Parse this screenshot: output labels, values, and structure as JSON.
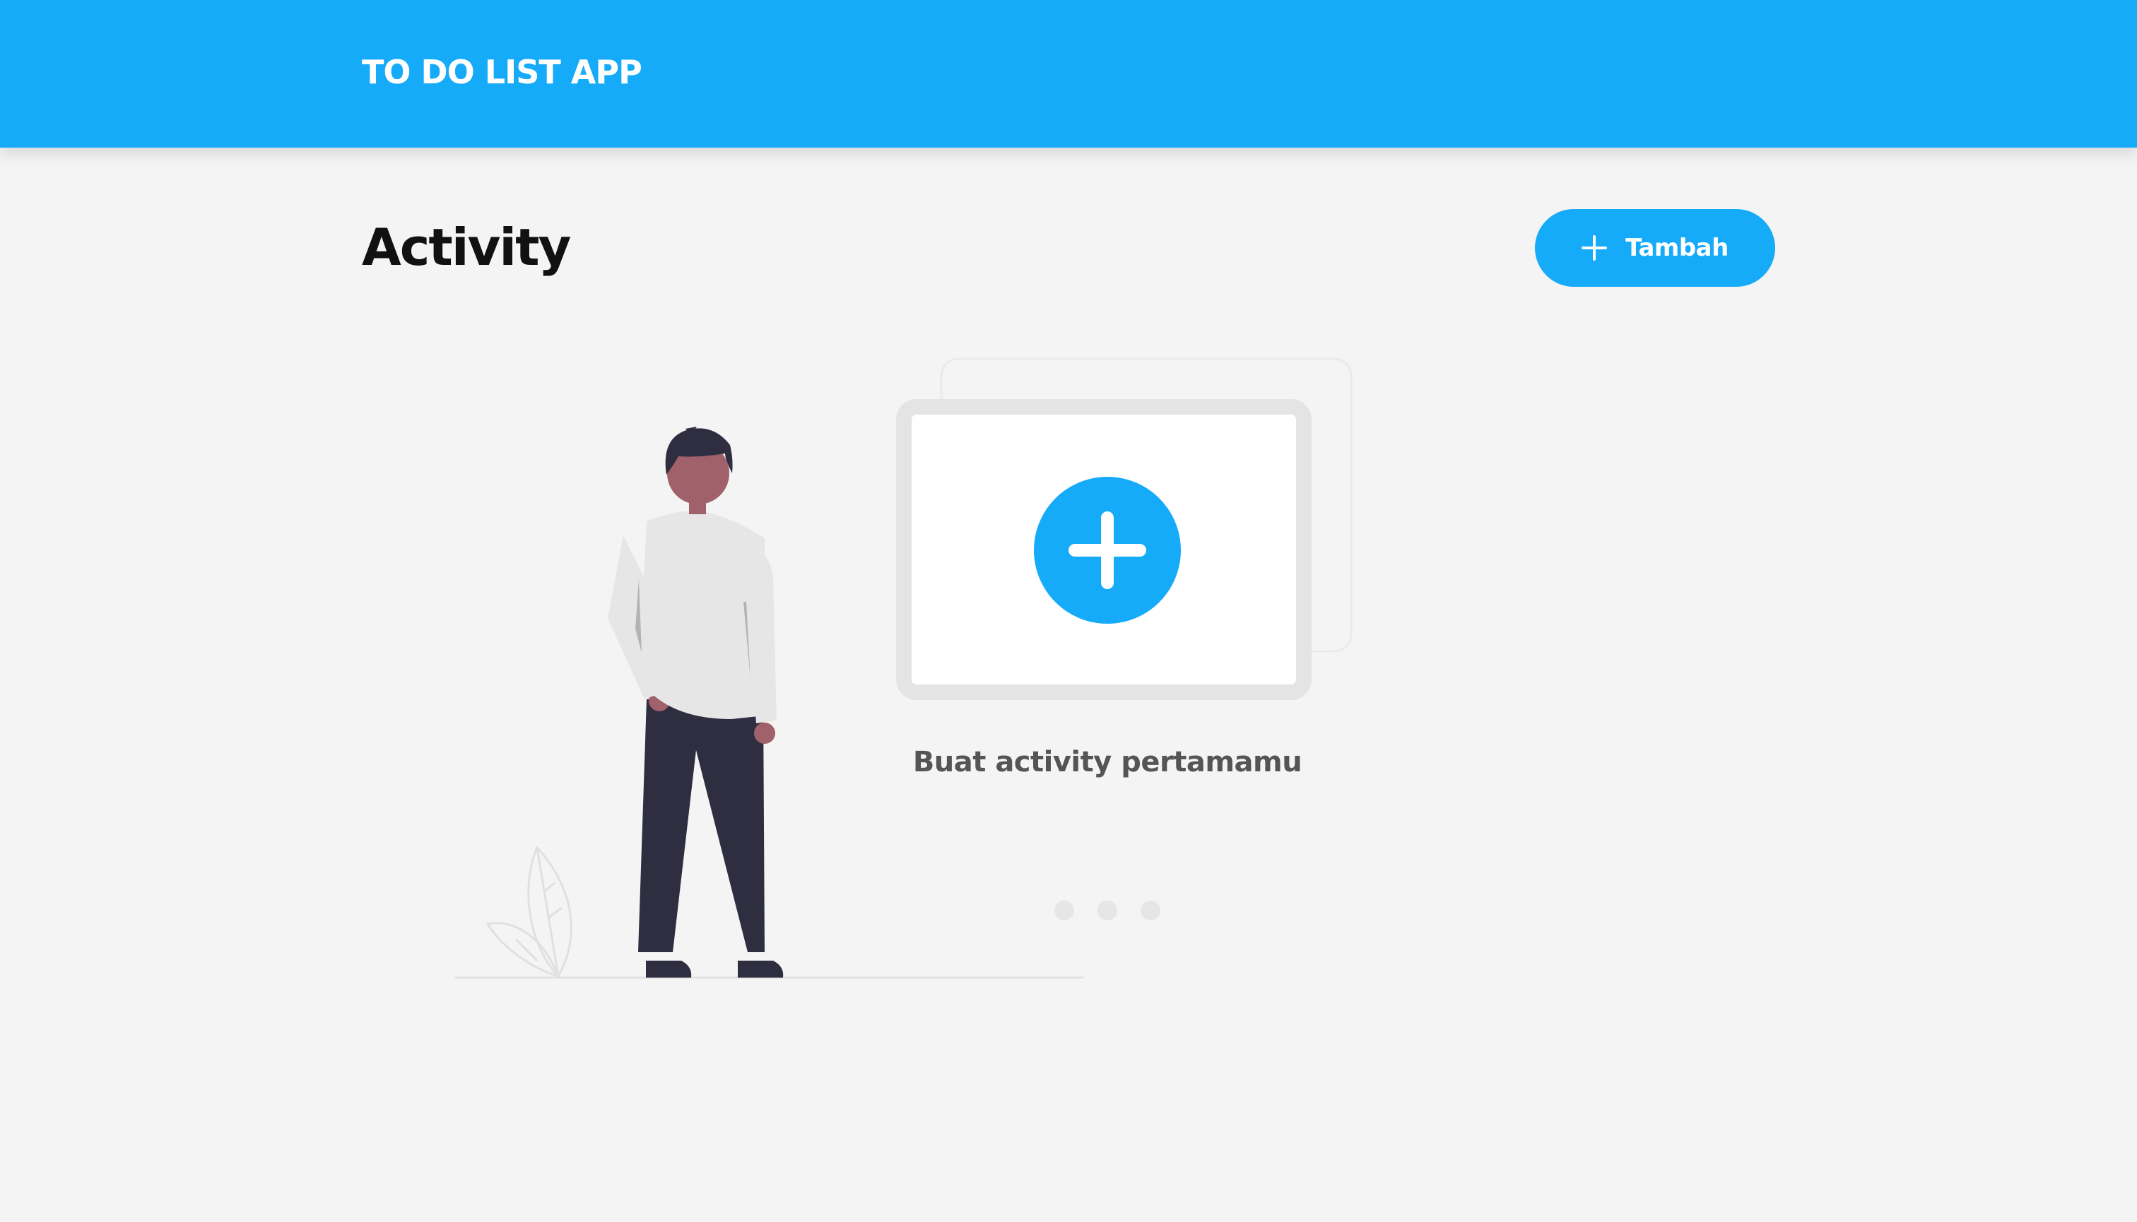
{
  "header": {
    "app_title": "TO DO LIST APP"
  },
  "main": {
    "page_title": "Activity",
    "add_button_label": "Tambah",
    "empty_state": {
      "message": "Buat activity pertamamu",
      "icon": "plus-circle-icon"
    }
  },
  "colors": {
    "primary": "#16abf8",
    "background": "#f4f4f4",
    "title_text": "#111111",
    "muted_text": "#555555"
  }
}
